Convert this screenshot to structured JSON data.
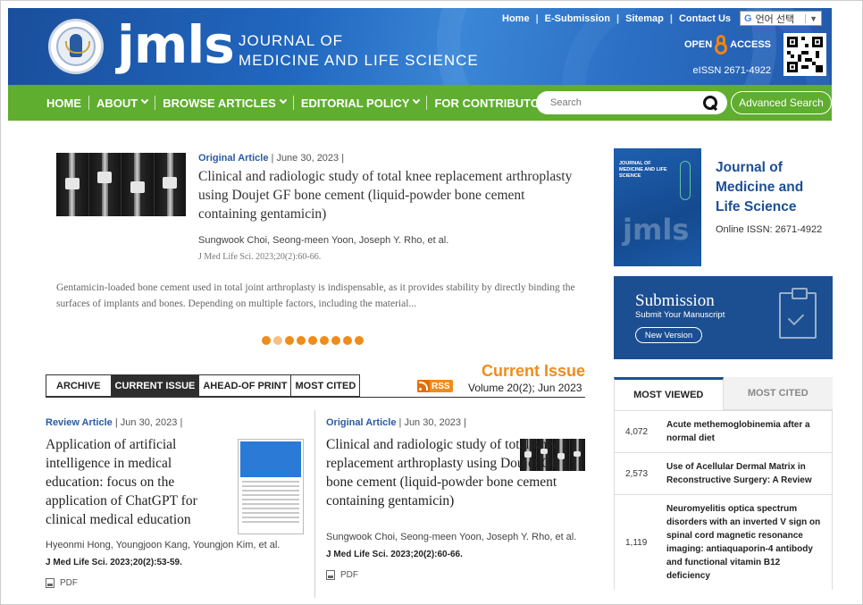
{
  "header": {
    "logo_text": "jmls",
    "journal_name_line1": "JOURNAL OF",
    "journal_name_line2": "MEDICINE AND LIFE SCIENCE",
    "top_links": [
      "Home",
      "E-Submission",
      "Sitemap",
      "Contact Us"
    ],
    "language_select": "언어 선택",
    "open_label": "OPEN",
    "access_label": "ACCESS",
    "eissn": "eISSN 2671-4922"
  },
  "nav": {
    "items": [
      "HOME",
      "ABOUT",
      "BROWSE ARTICLES",
      "EDITORIAL POLICY",
      "FOR CONTRIBUTORS"
    ],
    "search_placeholder": "Search",
    "advanced_search": "Advanced Search"
  },
  "featured": {
    "type": "Original Article",
    "date": "June 30, 2023",
    "title": "Clinical and radiologic study of total knee replacement arthroplasty using Doujet GF bone cement (liquid-powder bone cement containing gentamicin)",
    "authors": "Sungwook Choi, Seong-meen Yoon, Joseph Y. Rho, et al.",
    "citation": "J Med Life Sci. 2023;20(2):60-66.",
    "abstract": "Gentamicin-loaded bone cement used in total joint arthroplasty is indispensable, as it provides stability by directly binding the surfaces of implants and bones. Depending on multiple factors, including the material...",
    "carousel_count": 9,
    "carousel_active": 1
  },
  "issue": {
    "tabs": [
      "ARCHIVE",
      "CURRENT ISSUE",
      "AHEAD-OF PRINT",
      "MOST CITED"
    ],
    "active_tab": "CURRENT ISSUE",
    "heading": "Current Issue",
    "rss": "RSS",
    "volume": "Volume 20(2); Jun 2023"
  },
  "articles": [
    {
      "type": "Review Article",
      "date": "Jun 30, 2023",
      "title": "Application of artificial intelligence in medical education: focus on the application of ChatGPT for clinical medical education",
      "authors": "Hyeonmi Hong, Youngjoon Kang, Youngjon Kim, et al.",
      "citation": "J Med Life Sci. 2023;20(2):53-59.",
      "pdf": "PDF"
    },
    {
      "type": "Original Article",
      "date": "Jun 30, 2023",
      "title": "Clinical and radiologic study of total knee replacement arthroplasty using Doujet GF bone cement (liquid-powder bone cement containing gentamicin)",
      "authors": "Sungwook Choi, Seong-meen Yoon, Joseph Y. Rho, et al.",
      "citation": "J Med Life Sci. 2023;20(2):60-66.",
      "pdf": "PDF"
    }
  ],
  "sidebar": {
    "cover_text": "JOURNAL OF MEDICINE AND LIFE SCIENCE",
    "cover_logo": "jmls",
    "journal_title_line1": "Journal of",
    "journal_title_line2": "Medicine and",
    "journal_title_line3": "Life Science",
    "online_issn": "Online ISSN: 2671-4922",
    "submission_heading": "Submission",
    "submission_sub": "Submit Your Manuscript",
    "new_version": "New Version",
    "tabs": [
      "MOST VIEWED",
      "MOST CITED"
    ],
    "most_viewed": [
      {
        "count": "4,072",
        "title": "Acute methemoglobinemia after a normal diet"
      },
      {
        "count": "2,573",
        "title": "Use of Acellular Dermal Matrix in Reconstructive Surgery: A Review"
      },
      {
        "count": "1,119",
        "title": "Neuromyelitis optica spectrum disorders with an inverted V sign on spinal cord magnetic resonance imaging: antiaquaporin-4 antibody and functional vitamin B12 deficiency"
      }
    ]
  },
  "colors": {
    "header_blue": "#2167c0",
    "nav_green": "#5fae2f",
    "accent_orange": "#f08c1a",
    "link_blue": "#2a5ba3",
    "submission_blue": "#1c4f91"
  }
}
